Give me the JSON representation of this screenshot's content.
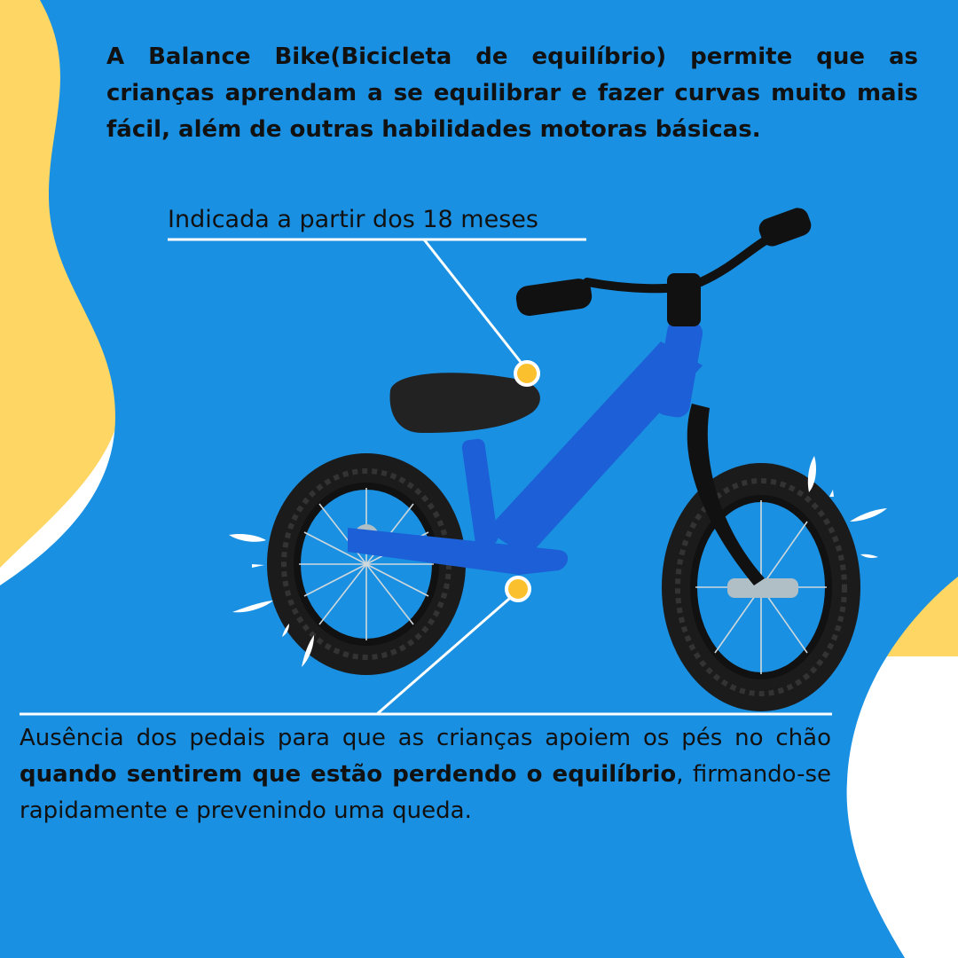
{
  "colors": {
    "background_blue": "#1a90e2",
    "accent_yellow": "#fdd663",
    "marker_yellow": "#fbc02d",
    "bike_blue": "#1c5fd6",
    "tire_black": "#1b1b1b",
    "line_white": "#ffffff"
  },
  "intro": {
    "text": "A Balance Bike(Bicicleta de equilíbrio) permite que as crianças aprendam a se equilibrar e fazer curvas muito mais fácil, além de outras habilidades motoras básicas."
  },
  "callouts": {
    "top": {
      "text": "Indicada a partir dos 18 meses"
    },
    "bottom": {
      "text_before": "Ausência dos pedais para que as crianças apoiem os pés no chão ",
      "text_bold": "quando sentirem que estão perdendo o equilíbrio",
      "text_after": ", firmando-se rapidamente e prevenindo uma queda."
    }
  },
  "product_image": {
    "subject": "blue balance bike",
    "icon": "balance-bike-illustration"
  }
}
